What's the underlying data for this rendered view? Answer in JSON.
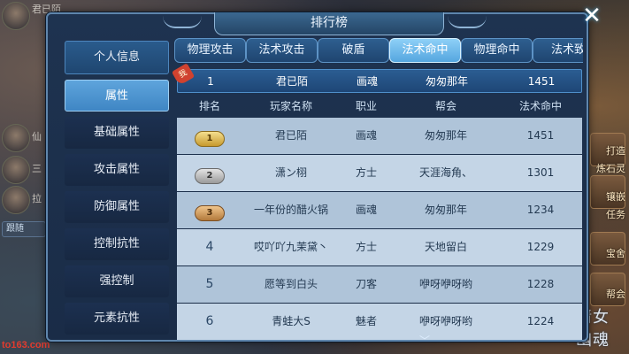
{
  "window": {
    "title": "排行榜"
  },
  "scene": {
    "left_labels": [
      "君已陌",
      "仙",
      "三",
      "拉",
      "跟随"
    ],
    "right_labels": [
      "打造",
      "炼石灵",
      "镶嵌",
      "任务",
      "宝舍",
      "帮会"
    ],
    "watermark_left": "to163.com",
    "logo_right": "倩女幽魂"
  },
  "menu": {
    "items": [
      {
        "label": "个人信息"
      },
      {
        "label": "属性"
      },
      {
        "label": "基础属性"
      },
      {
        "label": "攻击属性"
      },
      {
        "label": "防御属性"
      },
      {
        "label": "控制抗性"
      },
      {
        "label": "强控制"
      },
      {
        "label": "元素抗性"
      }
    ],
    "active_index": 1
  },
  "tabs": {
    "items": [
      {
        "label": "物理攻击"
      },
      {
        "label": "法术攻击"
      },
      {
        "label": "破盾"
      },
      {
        "label": "法术命中"
      },
      {
        "label": "物理命中"
      },
      {
        "label": "法术致"
      }
    ],
    "active_index": 3
  },
  "my_rank": {
    "badge": "我",
    "rank": "1",
    "name": "君已陌",
    "job": "画魂",
    "guild": "匆匆那年",
    "value": "1451"
  },
  "table": {
    "headers": [
      "排名",
      "玩家名称",
      "职业",
      "帮会",
      "法术命中"
    ],
    "rows": [
      {
        "rank": "1",
        "name": "君已陌",
        "job": "画魂",
        "guild": "匆匆那年",
        "value": "1451"
      },
      {
        "rank": "2",
        "name": "潇ン栩",
        "job": "方士",
        "guild": "天涯海角、",
        "value": "1301"
      },
      {
        "rank": "3",
        "name": "一年份的醋火锅",
        "job": "画魂",
        "guild": "匆匆那年",
        "value": "1234"
      },
      {
        "rank": "4",
        "name": "哎吖吖九茉黛丶",
        "job": "方士",
        "guild": "天地留白",
        "value": "1229"
      },
      {
        "rank": "5",
        "name": "愿等到白头",
        "job": "刀客",
        "guild": "咿呀咿呀哟",
        "value": "1228"
      },
      {
        "rank": "6",
        "name": "青蛙大S",
        "job": "魅者",
        "guild": "咿呀咿呀哟",
        "value": "1224"
      }
    ]
  },
  "icons": {
    "close": "close-icon",
    "scroll": "chevron-down-icon"
  }
}
